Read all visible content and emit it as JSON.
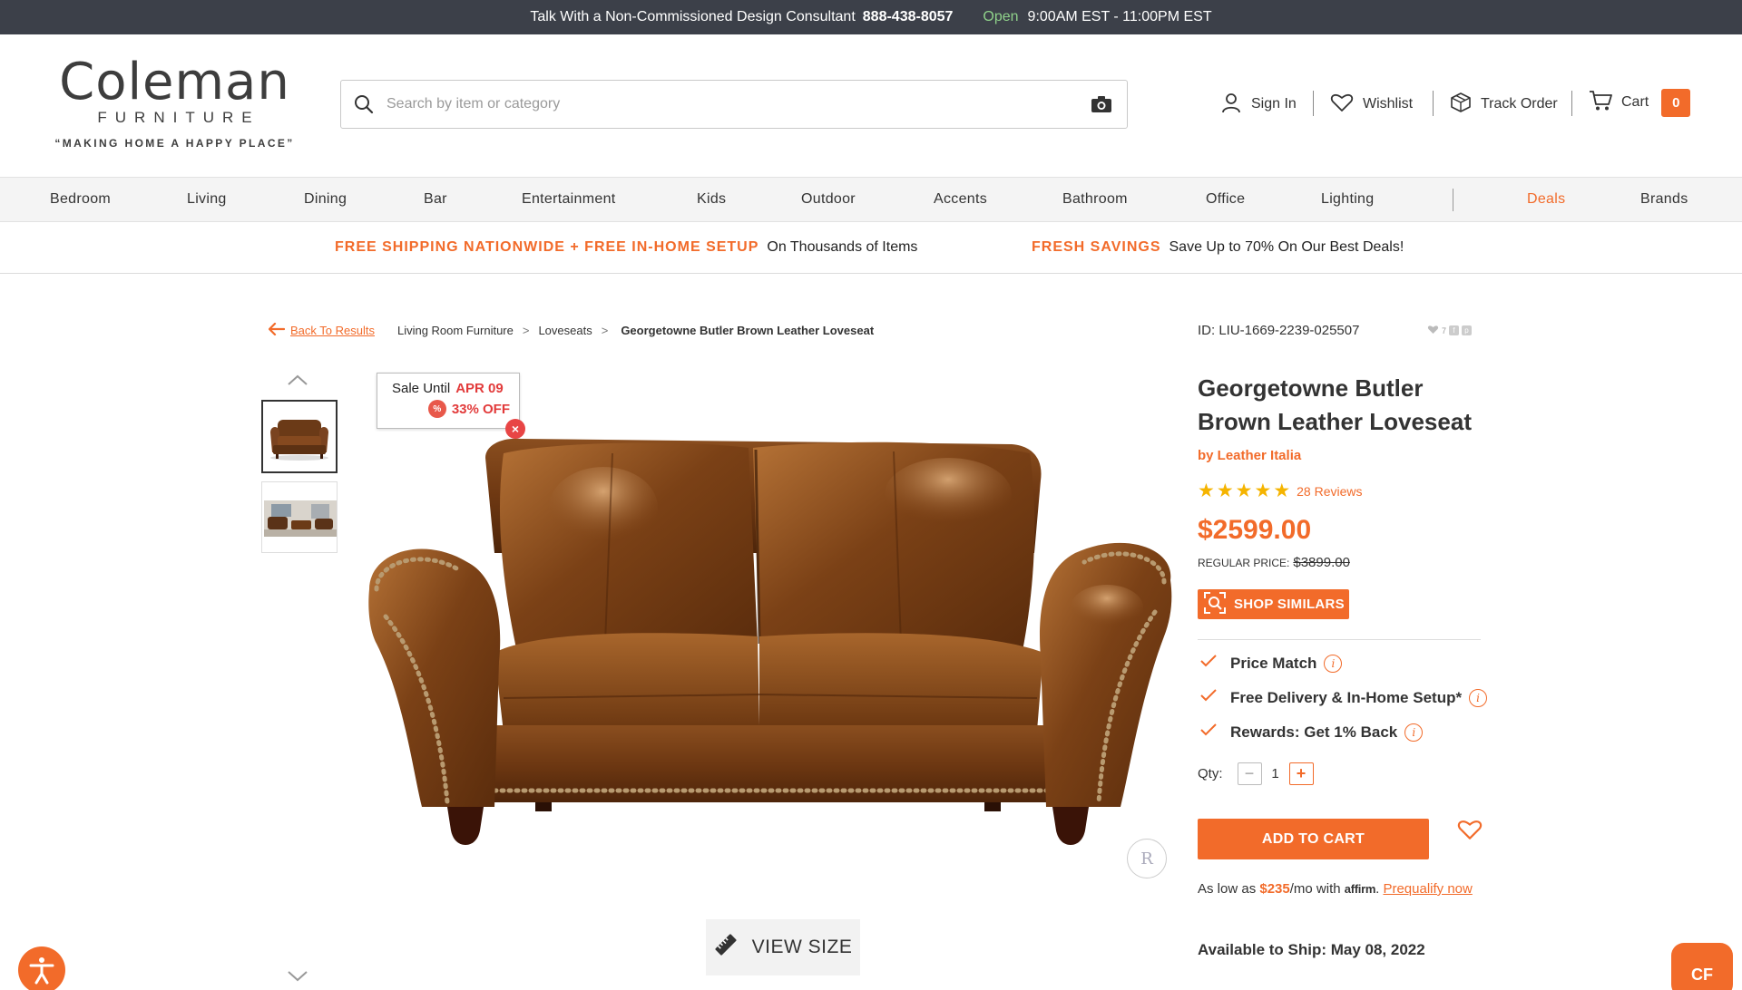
{
  "topbar": {
    "talk_text": "Talk With a Non-Commissioned Design Consultant",
    "phone": "888-438-8057",
    "open_label": "Open",
    "hours": "9:00AM EST - 11:00PM EST"
  },
  "logo": {
    "brand": "Coleman",
    "sub": "FURNITURE",
    "tagline": "“MAKING HOME A HAPPY PLACE”"
  },
  "search": {
    "placeholder": "Search by item or category"
  },
  "utility": {
    "sign_in": "Sign In",
    "wishlist": "Wishlist",
    "track_order": "Track Order",
    "cart": "Cart",
    "cart_count": "0"
  },
  "nav": {
    "items": [
      "Bedroom",
      "Living",
      "Dining",
      "Bar",
      "Entertainment",
      "Kids",
      "Outdoor",
      "Accents",
      "Bathroom",
      "Office",
      "Lighting"
    ],
    "deals": "Deals",
    "brands": "Brands"
  },
  "promo": {
    "shipping_strong": "FREE SHIPPING NATIONWIDE + FREE IN-HOME SETUP",
    "shipping_text": "On Thousands of Items",
    "savings_strong": "FRESH SAVINGS",
    "savings_text": "Save Up to 70% On Our Best Deals!"
  },
  "breadcrumb": {
    "back": "Back To Results",
    "items": [
      "Living Room Furniture",
      "Loveseats",
      "Georgetowne Butler Brown Leather Loveseat"
    ],
    "separator": ">"
  },
  "product": {
    "id_text": "ID: LIU-1669-2239-025507",
    "wish_count": "7",
    "title": "Georgetowne Butler Brown Leather Loveseat",
    "brand": "by Leather Italia",
    "rating": 5,
    "reviews": "28 Reviews",
    "price": "$2599.00",
    "regular_label": "REGULAR PRICE:",
    "regular_price": "$3899.00",
    "shop_similars": "SHOP SIMILARS",
    "features": [
      "Price Match",
      "Free Delivery & In-Home Setup*",
      "Rewards: Get 1% Back"
    ],
    "qty_label": "Qty:",
    "qty_value": "1",
    "add_to_cart": "ADD TO CART",
    "affirm_prefix": "As low as",
    "affirm_amount": "$235",
    "affirm_mid": "/mo with",
    "affirm_brand": "affirm",
    "affirm_link": "Prequalify now",
    "availability": "Available to Ship: May 08, 2022"
  },
  "sale_tag": {
    "label": "Sale Until",
    "date": "APR 09",
    "percent_icon": "%",
    "discount": "33% OFF"
  },
  "view_size": "VIEW SIZE",
  "chat_label": "CF",
  "colors": {
    "accent": "#f26b2a",
    "topbar": "#3c4049",
    "star": "#f5b400",
    "sale_red": "#e23b3b"
  }
}
